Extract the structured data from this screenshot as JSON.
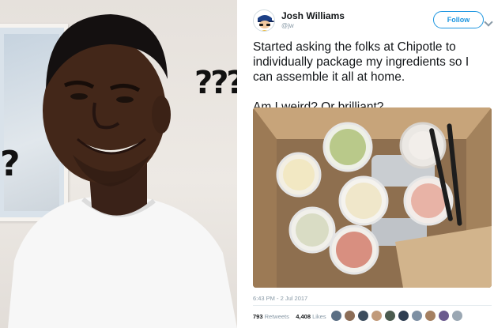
{
  "meme": {
    "question_marks_right": "???",
    "question_mark_left": "?"
  },
  "tweet": {
    "display_name": "Josh Williams",
    "handle": "@jw",
    "follow_label": "Follow",
    "text_line_1": "Started asking the folks at Chipotle to individually package my ingredients so I can assemble it all at home.",
    "text_line_2": "Am I weird? Or brilliant?",
    "timestamp": "6:43 PM - 2 Jul 2017",
    "retweets_count": "793",
    "retweets_label": "Retweets",
    "likes_count": "4,408",
    "likes_label": "Likes",
    "liker_avatars": [
      "#5b6f84",
      "#8c6d57",
      "#3d4d5e",
      "#c19a7a",
      "#4b5b4f",
      "#2f3e52",
      "#7d8fa3",
      "#a58061",
      "#6b5b8e",
      "#9aa7b3"
    ]
  },
  "colors": {
    "accent": "#1b95e0",
    "text": "#14171a",
    "muted": "#8899a6"
  }
}
